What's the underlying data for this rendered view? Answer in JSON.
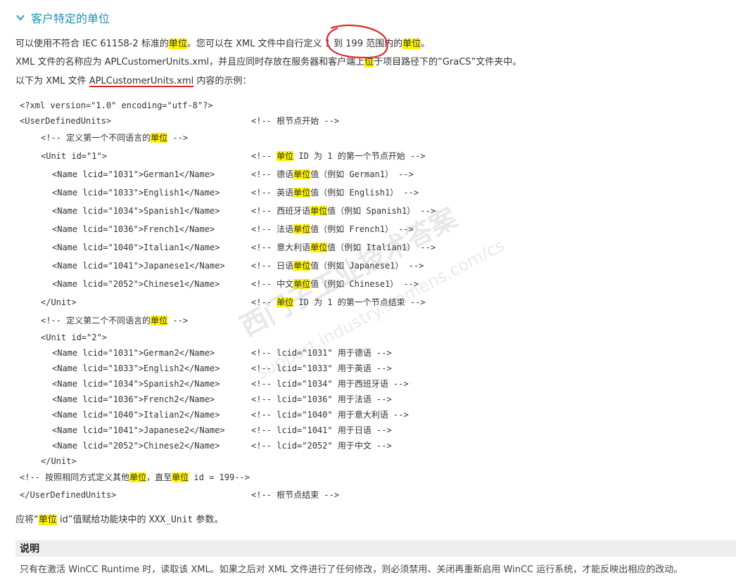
{
  "section": {
    "title": "客户特定的单位"
  },
  "intro": {
    "line1": {
      "a": "可以使用不符合 IEC 61158-2 标准的",
      "b": "单位",
      "c": "。您可以在 XML 文件中自行定义 1 到 199 范围内的",
      "d": "单位",
      "e": "。"
    },
    "line2": {
      "a": "XML 文件的名称应为 APLCustomerUnits.xml，并且应同时存放在服务器和客户端上",
      "b": "位",
      "c": "于项目路径下的“GraCS”文件夹中。"
    },
    "line3": {
      "a": "以下为 XML 文件 ",
      "b": "APLCustomerUnits.xml",
      "c": " 内容的示例："
    }
  },
  "code": {
    "l1": "<?xml version=\"1.0\" encoding=\"utf-8\"?>",
    "l2": {
      "a": "<UserDefinedUnits>",
      "b": "<!-- 根节点开始 -->"
    },
    "l3": {
      "a": "<!-- 定义第一个不同语言的",
      "b": "单位",
      "c": " -->"
    },
    "l4": {
      "a": "<Unit id=\"1\">",
      "b": "<!-- ",
      "c": "单位",
      "d": " ID 为 1 的第一个节点开始 -->"
    },
    "u1": [
      {
        "tag": "<Name lcid=\"1031\">German1</Name>",
        "c1": "<!-- 德语",
        "hl": "单位",
        "c2": "值（例如 German1） -->"
      },
      {
        "tag": "<Name lcid=\"1033\">English1</Name>",
        "c1": "<!-- 英语",
        "hl": "单位",
        "c2": "值（例如 English1） -->"
      },
      {
        "tag": "<Name lcid=\"1034\">Spanish1</Name>",
        "c1": "<!-- 西班牙语",
        "hl": "单位",
        "c2": "值（例如 Spanish1） -->"
      },
      {
        "tag": "<Name lcid=\"1036\">French1</Name>",
        "c1": "<!-- 法语",
        "hl": "单位",
        "c2": "值（例如 French1） -->"
      },
      {
        "tag": "<Name lcid=\"1040\">Italian1</Name>",
        "c1": "<!-- 意大利语",
        "hl": "单位",
        "c2": "值（例如 Italian1） -->"
      },
      {
        "tag": "<Name lcid=\"1041\">Japanese1</Name>",
        "c1": "<!-- 日语",
        "hl": "单位",
        "c2": "值（例如 Japanese1） -->"
      },
      {
        "tag": "<Name lcid=\"2052\">Chinese1</Name>",
        "c1": "<!-- 中文",
        "hl": "单位",
        "c2": "值（例如 Chinese1） -->"
      }
    ],
    "l12": {
      "a": "</Unit>",
      "b": "<!-- ",
      "c": "单位",
      "d": " ID 为 1 的第一个节点结束 -->"
    },
    "l13": {
      "a": "<!-- 定义第二个不同语言的",
      "b": "单位",
      "c": " -->"
    },
    "l14": "<Unit id=\"2\">",
    "u2": [
      {
        "tag": "<Name lcid=\"1031\">German2</Name>",
        "cm": "<!-- lcid=\"1031\" 用于德语 -->"
      },
      {
        "tag": "<Name lcid=\"1033\">English2</Name>",
        "cm": "<!-- lcid=\"1033\" 用于英语 -->"
      },
      {
        "tag": "<Name lcid=\"1034\">Spanish2</Name>",
        "cm": "<!-- lcid=\"1034\" 用于西班牙语 -->"
      },
      {
        "tag": "<Name lcid=\"1036\">French2</Name>",
        "cm": "<!-- lcid=\"1036\" 用于法语 -->"
      },
      {
        "tag": "<Name lcid=\"1040\">Italian2</Name>",
        "cm": "<!-- lcid=\"1040\" 用于意大利语 -->"
      },
      {
        "tag": "<Name lcid=\"1041\">Japanese2</Name>",
        "cm": "<!-- lcid=\"1041\" 用于日语 -->"
      },
      {
        "tag": "<Name lcid=\"2052\">Chinese2</Name>",
        "cm": "<!-- lcid=\"2052\" 用于中文 -->"
      }
    ],
    "l22": "</Unit>",
    "l23": {
      "a": "<!-- 按照相同方式定义其他",
      "b": "单位",
      "c": "，直至",
      "d": "单位",
      "e": " id = 199-->"
    },
    "l24": {
      "a": "</UserDefinedUnits>",
      "b": "<!-- 根节点结束 -->"
    }
  },
  "assign": {
    "a": "应将“",
    "b": "单位",
    "c": " id”值赋给功能块中的 ",
    "d": "XXX_Unit",
    "e": " 参数。"
  },
  "note": {
    "title": "说明",
    "text": "只有在激活 WinCC Runtime 时，读取该 XML。如果之后对 XML 文件进行了任何修改，则必须禁用、关闭再重新启用 WinCC 运行系统，才能反映出相应的改动。"
  },
  "watermark": {
    "line1": "西门子工业技术答案",
    "line2": "support.industry.siemens.com/cs"
  },
  "colors": {
    "heading": "#1f8fb5",
    "highlight": "#fff200",
    "annotation": "#e0242a"
  }
}
